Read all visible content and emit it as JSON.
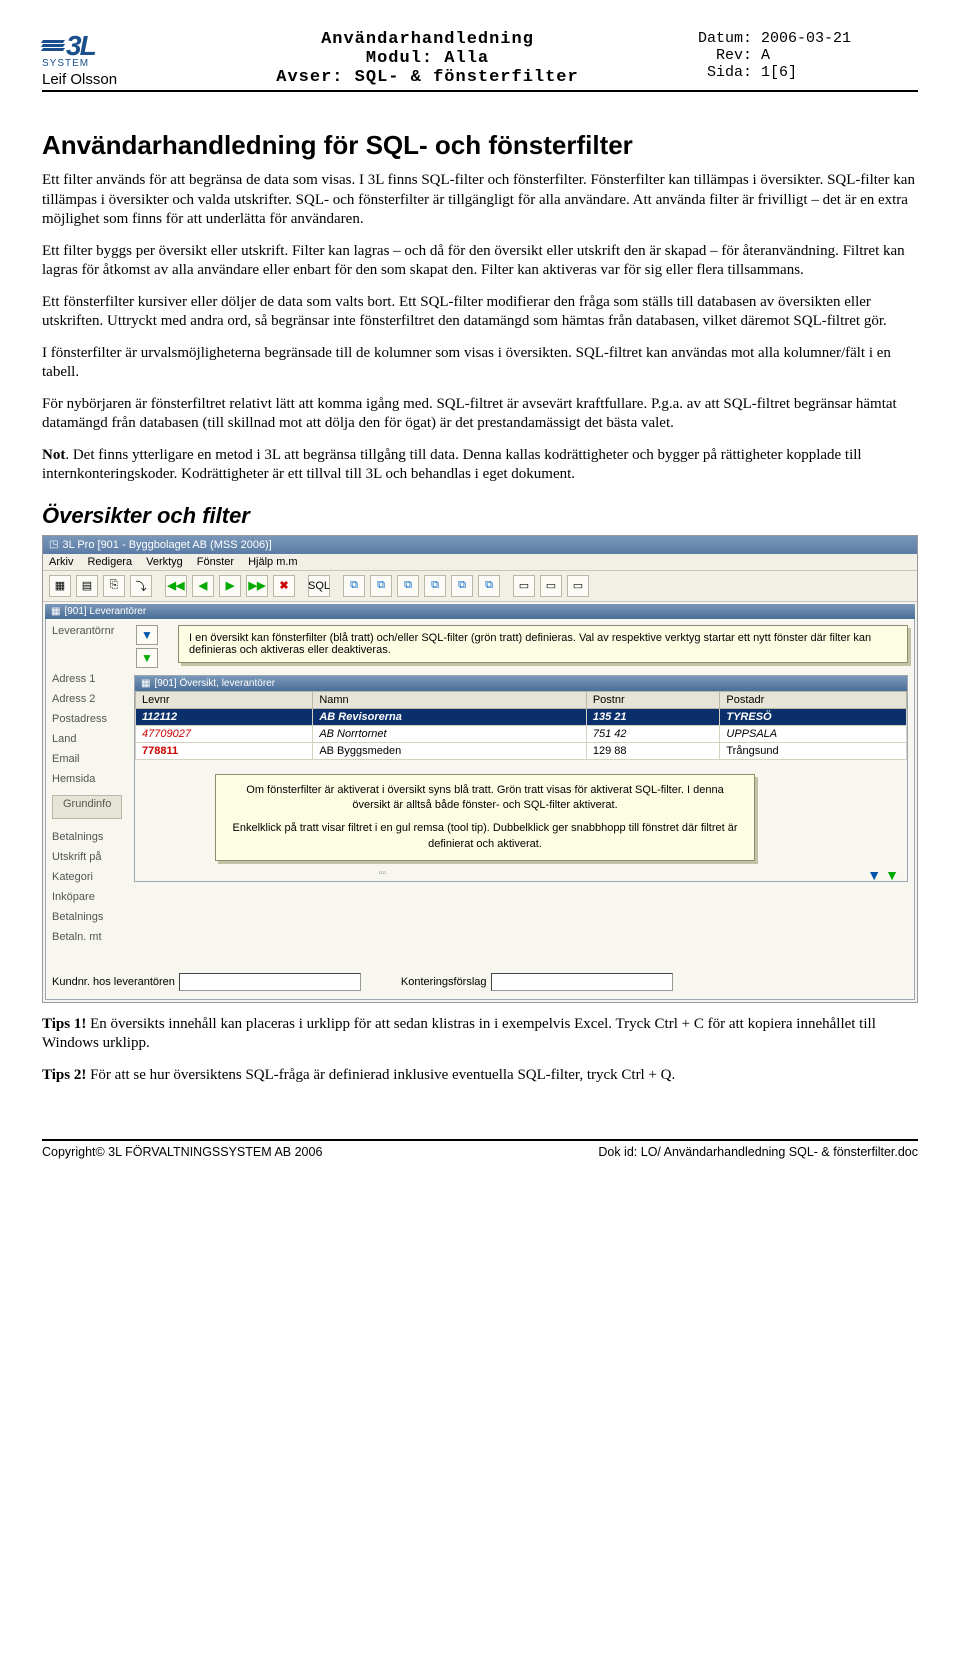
{
  "header": {
    "author": "Leif Olsson",
    "logo_text": "3L",
    "logo_sub": "SYSTEM",
    "title_l1": "Användarhandledning",
    "title_l2": "Modul: Alla",
    "title_l3": "Avser: SQL- & fönsterfilter",
    "meta_date": "Datum: 2006-03-21",
    "meta_rev": "  Rev: A",
    "meta_page": " Sida: 1[6]"
  },
  "h1": "Användarhandledning för SQL- och fönsterfilter",
  "p1": "Ett filter används för att begränsa de data som visas. I 3L finns SQL-filter och fönsterfilter. Fönsterfilter kan tillämpas i översikter. SQL-filter kan tillämpas i översikter och valda utskrifter. SQL- och fönsterfilter är tillgängligt för alla användare. Att använda filter är frivilligt – det är en extra möjlighet som finns för att underlätta för användaren.",
  "p2": "Ett filter byggs per översikt eller utskrift. Filter kan lagras – och då för den översikt eller utskrift den är skapad – för återanvändning. Filtret kan lagras för åtkomst av alla användare eller enbart för den som skapat den. Filter kan aktiveras var för sig eller flera tillsammans.",
  "p3": "Ett fönsterfilter kursiver eller döljer de data som valts bort. Ett SQL-filter modifierar den fråga som ställs till databasen av översikten eller utskriften. Uttryckt med andra ord, så begränsar inte fönsterfiltret den datamängd som hämtas från databasen, vilket däremot SQL-filtret gör.",
  "p4": "I fönsterfilter är urvalsmöjligheterna begränsade till de kolumner som visas i översikten. SQL-filtret kan användas mot alla kolumner/fält i en tabell.",
  "p5": "För nybörjaren är fönsterfiltret relativt lätt att komma igång med. SQL-filtret är avsevärt kraftfullare. P.g.a. av att SQL-filtret begränsar hämtat datamängd från databasen (till skillnad mot att dölja den för ögat) är det prestandamässigt det bästa valet.",
  "p6a": "Not",
  "p6b": ". Det finns ytterligare en metod i 3L att begränsa tillgång till data. Denna kallas kodrättigheter och bygger på rättigheter kopplade till internkonteringskoder. Kodrättigheter är ett tillval till 3L och behandlas i eget dokument.",
  "h2": "Översikter och filter",
  "shot": {
    "app_title": "3L Pro  [901 - Byggbolaget AB (MSS 2006)]",
    "menu": [
      "Arkiv",
      "Redigera",
      "Verktyg",
      "Fönster",
      "Hjälp m.m"
    ],
    "sub1_title": "[901] Leverantörer",
    "lev_label": "Leverantörnr",
    "callout1": "I en översikt kan fönsterfilter (blå tratt) och/eller SQL-filter (grön tratt) definieras. Val av respektive verktyg startar ett nytt fönster där filter kan definieras och aktiveras eller deaktiveras.",
    "side": [
      "Adress 1",
      "Adress 2",
      "Postadress",
      "Land",
      "Email",
      "Hemsida"
    ],
    "tab": "Grundinfo",
    "inner_title": "[901] Översikt, leverantörer",
    "cols": [
      "Levnr",
      "Namn",
      "Postnr",
      "Postadr"
    ],
    "rows": [
      {
        "levnr": "112112",
        "namn": "AB Revisorerna",
        "postnr": "135 21",
        "postadr": "TYRESÖ",
        "sel": true
      },
      {
        "levnr": "47709027",
        "namn": "AB Norrtornet",
        "postnr": "751 42",
        "postadr": "UPPSALA",
        "sel": false,
        "red": true
      },
      {
        "levnr": "778811",
        "namn": "AB Byggsmeden",
        "postnr": "129 88",
        "postadr": "Trångsund",
        "sel": false,
        "redlev": true
      }
    ],
    "callout2a": "Om fönsterfilter är aktiverat i översikt syns blå tratt. Grön tratt visas för aktiverat SQL-filter. I denna översikt är alltså både fönster- och SQL-filter aktiverat.",
    "callout2b": "Enkelklick på tratt visar filtret i en gul remsa (tool tip). Dubbelklick ger snabbhopp till fönstret där filtret är definierat och aktiverat.",
    "side2": [
      "Betalnings",
      "Utskrift på",
      "Kategori",
      "Inköpare",
      "Betalnings",
      "Betaln. mt"
    ],
    "bottom1": "Kundnr. hos leverantören",
    "bottom2": "Konteringsförslag"
  },
  "tip1a": "Tips 1!",
  "tip1b": " En översikts innehåll kan placeras i urklipp för att sedan klistras in i exempelvis Excel. Tryck Ctrl + C för att kopiera innehållet till Windows urklipp.",
  "tip2a": "Tips 2!",
  "tip2b": " För att se hur översiktens SQL-fråga är definierad inklusive eventuella SQL-filter, tryck Ctrl + Q.",
  "footer": {
    "left_a": "Copyright© 3L F",
    "left_b": "ÖRVALTNINGSSYSTEM",
    "left_c": " AB 2006",
    "right": "Dok id: LO/ Användarhandledning SQL- & fönsterfilter.doc"
  }
}
